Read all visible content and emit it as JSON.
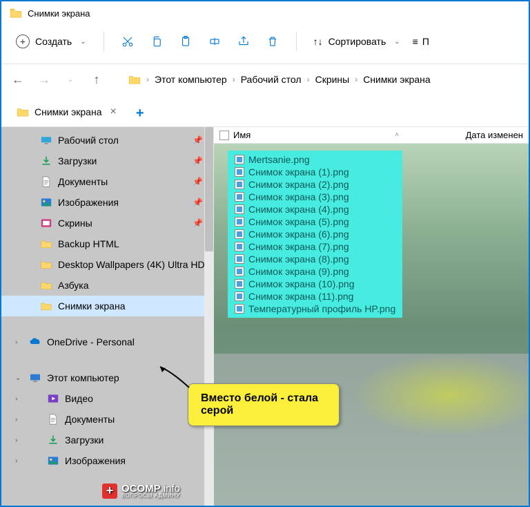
{
  "window": {
    "title": "Снимки экрана"
  },
  "toolbar": {
    "new_label": "Создать",
    "sort_label": "Сортировать",
    "view_label": "П"
  },
  "breadcrumb": {
    "items": [
      "Этот компьютер",
      "Рабочий стол",
      "Скрины",
      "Снимки экрана"
    ]
  },
  "tab": {
    "label": "Снимки экрана"
  },
  "columns": {
    "name": "Имя",
    "date": "Дата изменен"
  },
  "sidebar": {
    "items": [
      {
        "label": "Рабочий стол",
        "icon": "desktop",
        "pin": true
      },
      {
        "label": "Загрузки",
        "icon": "download",
        "pin": true
      },
      {
        "label": "Документы",
        "icon": "document",
        "pin": true
      },
      {
        "label": "Изображения",
        "icon": "picture",
        "pin": true
      },
      {
        "label": "Скрины",
        "icon": "screenshot",
        "pin": true
      },
      {
        "label": "Backup HTML",
        "icon": "folder"
      },
      {
        "label": "Desktop Wallpapers (4K) Ultra HD",
        "icon": "folder"
      },
      {
        "label": "Азбука",
        "icon": "folder"
      },
      {
        "label": "Снимки экрана",
        "icon": "folder",
        "selected": true
      }
    ],
    "section2": [
      {
        "label": "OneDrive - Personal",
        "icon": "onedrive",
        "exp": ">"
      }
    ],
    "section3_title": "Этот компьютер",
    "section3": [
      {
        "label": "Видео",
        "icon": "video"
      },
      {
        "label": "Документы",
        "icon": "document"
      },
      {
        "label": "Загрузки",
        "icon": "download"
      },
      {
        "label": "Изображения",
        "icon": "picture"
      }
    ]
  },
  "files": [
    "Mertsanie.png",
    "Снимок экрана (1).png",
    "Снимок экрана (2).png",
    "Снимок экрана (3).png",
    "Снимок экрана (4).png",
    "Снимок экрана (5).png",
    "Снимок экрана (6).png",
    "Снимок экрана (7).png",
    "Снимок экрана (8).png",
    "Снимок экрана (9).png",
    "Снимок экрана (10).png",
    "Снимок экрана (11).png",
    "Температурный профиль HP.png"
  ],
  "callout": {
    "text": "Вместо белой - стала серой"
  },
  "watermark": {
    "brand": "OCOMP",
    "tld": ".info",
    "sub": "ВОПРОСЫ АДМИНУ"
  }
}
